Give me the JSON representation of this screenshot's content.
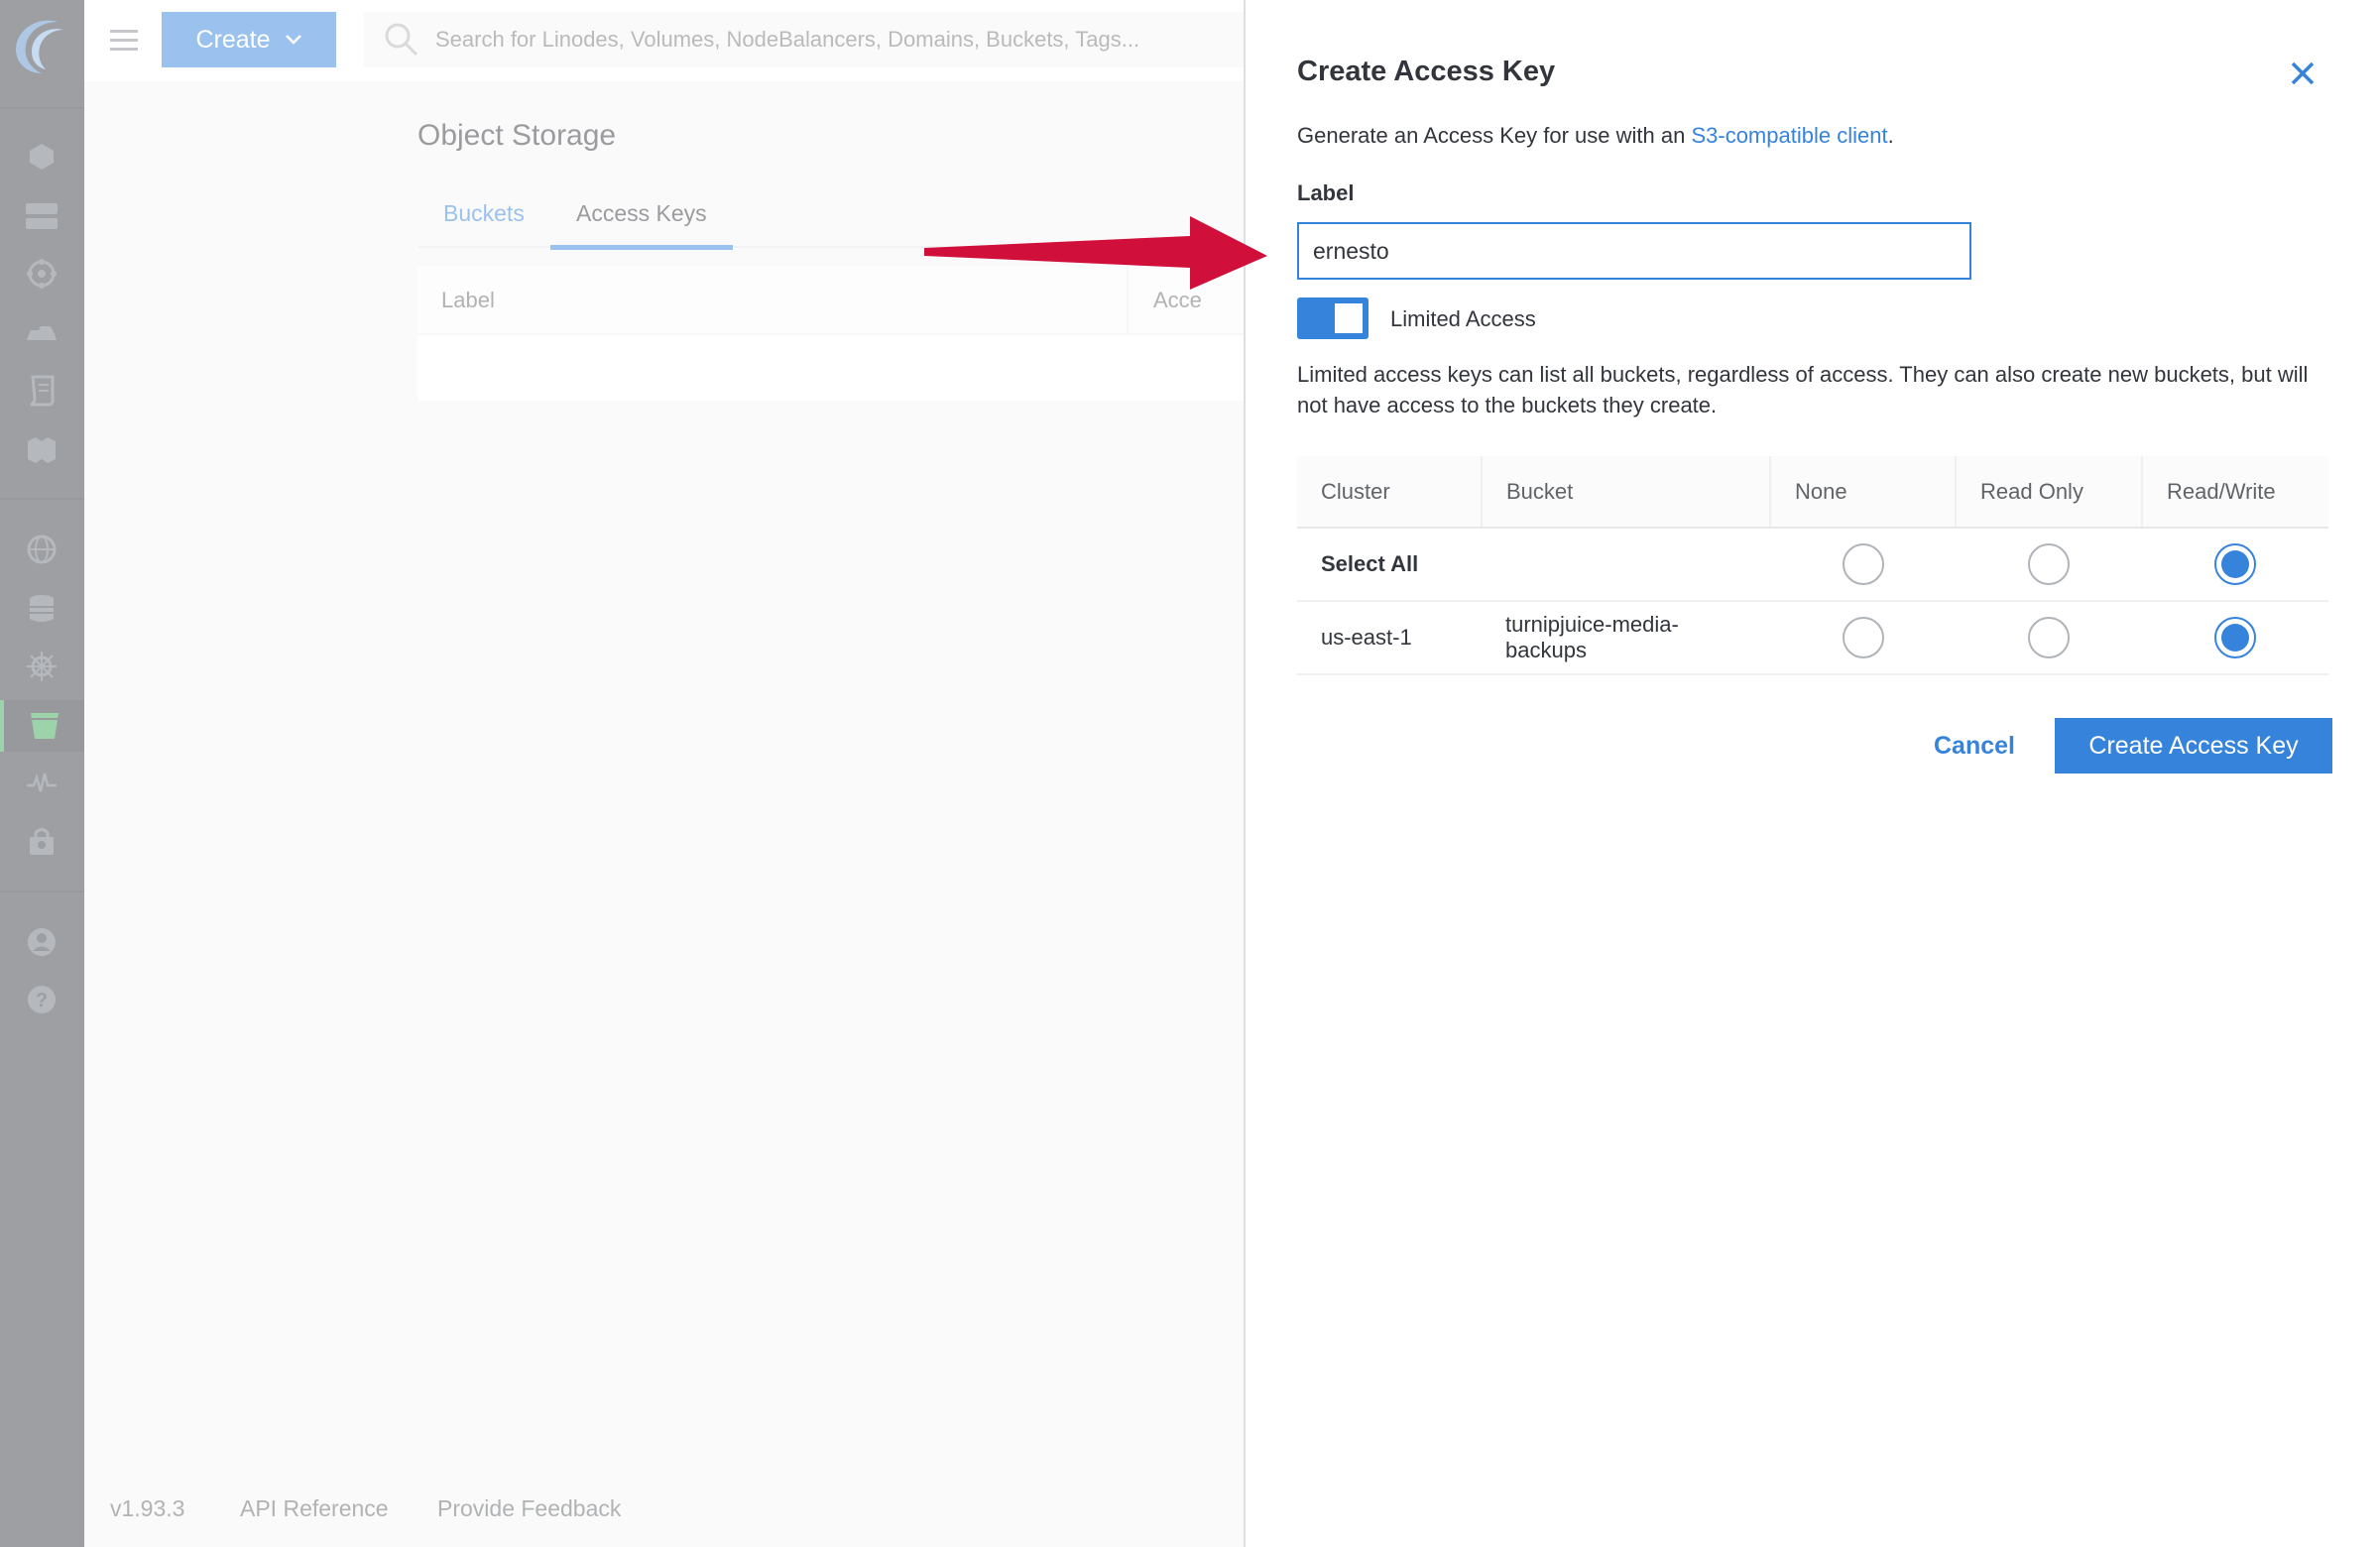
{
  "topbar": {
    "create_label": "Create",
    "search_placeholder": "Search for Linodes, Volumes, NodeBalancers, Domains, Buckets, Tags..."
  },
  "nav": {
    "items": [
      "linodes-icon",
      "volumes-icon",
      "nodebalancers-icon",
      "managed-icon",
      "stackscripts-icon",
      "images-icon",
      "domains-icon",
      "databases-icon",
      "kubernetes-icon",
      "object-storage-icon",
      "longview-icon",
      "marketplace-icon",
      "account-icon",
      "help-icon"
    ],
    "active": "object-storage-icon",
    "active_color": "#3aa655"
  },
  "page": {
    "title": "Object Storage",
    "tabs": [
      {
        "label": "Buckets"
      },
      {
        "label": "Access Keys"
      }
    ],
    "table_headers": [
      "Label",
      "Acce"
    ]
  },
  "footer": {
    "version": "v1.93.3",
    "api_reference": "API Reference",
    "feedback": "Provide Feedback"
  },
  "drawer": {
    "title": "Create Access Key",
    "description_prefix": "Generate an Access Key for use with an ",
    "description_link": "S3-compatible client",
    "description_suffix": ".",
    "label_caption": "Label",
    "label_value": "ernesto",
    "limited_access_label": "Limited Access",
    "limited_access_on": true,
    "help_text": "Limited access keys can list all buckets, regardless of access. They can also create new buckets, but will not have access to the buckets they create.",
    "table": {
      "headers": [
        "Cluster",
        "Bucket",
        "None",
        "Read Only",
        "Read/Write"
      ],
      "select_all_label": "Select All",
      "rows": [
        {
          "cluster": "us-east-1",
          "bucket": "turnipjuice-media-backups",
          "permission": "Read/Write"
        }
      ]
    },
    "cancel_label": "Cancel",
    "submit_label": "Create Access Key"
  },
  "colors": {
    "accent": "#3683dc",
    "annotation_arrow": "#d0103a"
  }
}
